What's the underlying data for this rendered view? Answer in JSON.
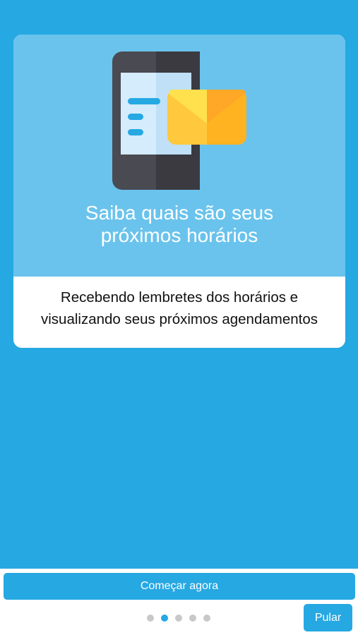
{
  "card": {
    "title_line1": "Saiba quais são seus",
    "title_line2": "próximos horários",
    "description_line1": "Recebendo lembretes dos horários e",
    "description_line2": "visualizando seus próximos agendamentos",
    "illustration_icon": "phone-with-envelope-icon"
  },
  "footer": {
    "start_label": "Começar agora",
    "skip_label": "Pular",
    "pagination": {
      "total": 5,
      "active_index": 1
    }
  },
  "colors": {
    "background": "#26a8e2",
    "card_top": "#6ac3ec",
    "accent": "#26a8e2",
    "dot_inactive": "#c8c8c8"
  }
}
